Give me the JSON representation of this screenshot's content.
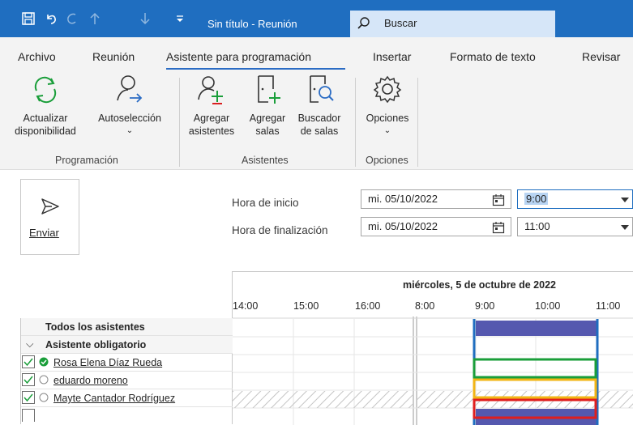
{
  "titlebar": {
    "title": "Sin título  -  Reunión",
    "search_label": "Buscar",
    "icons": [
      "save-icon",
      "undo-icon",
      "redo-icon",
      "up-arrow-icon",
      "down-arrow-icon",
      "customize-icon",
      "search-icon"
    ]
  },
  "menu": {
    "tabs": [
      "Archivo",
      "Reunión",
      "Asistente para programación",
      "Insertar",
      "Formato de texto",
      "Revisar"
    ],
    "active": "Asistente para programación"
  },
  "ribbon": {
    "groups": {
      "programacion": "Programación",
      "asistentes": "Asistentes",
      "opciones": "Opciones"
    },
    "buttons": {
      "actualizar_1": "Actualizar",
      "actualizar_2": "disponibilidad",
      "autoseleccion": "Autoselección",
      "agregar_asistentes_1": "Agregar",
      "agregar_asistentes_2": "asistentes",
      "agregar_salas_1": "Agregar",
      "agregar_salas_2": "salas",
      "buscador_1": "Buscador",
      "buscador_2": "de salas",
      "opciones": "Opciones"
    }
  },
  "form": {
    "send_label": "Enviar",
    "start_label": "Hora de inicio",
    "end_label": "Hora de finalización",
    "start_date": "mi. 05/10/2022",
    "end_date": "mi. 05/10/2022",
    "start_time": "9:00",
    "end_time": "11:00"
  },
  "schedule": {
    "date_header": "miércoles, 5 de octubre de 2022",
    "hours": [
      "14:00",
      "15:00",
      "16:00",
      "8:00",
      "9:00",
      "10:00",
      "11:00"
    ],
    "all_attendees": "Todos los asistentes",
    "required_group": "Asistente obligatorio",
    "attendees": [
      {
        "name": "Rosa Elena Díaz Rueda",
        "status": "available"
      },
      {
        "name": "eduardo moreno",
        "status": "unknown"
      },
      {
        "name": "Mayte Cantador Rodríguez",
        "status": "unknown"
      }
    ],
    "highlight_colors": {
      "row1": "#1a9e3a",
      "row2": "#f2b515",
      "row3": "#e01e1e",
      "meeting": "#5558af",
      "selection": "#1f6ec0"
    }
  }
}
